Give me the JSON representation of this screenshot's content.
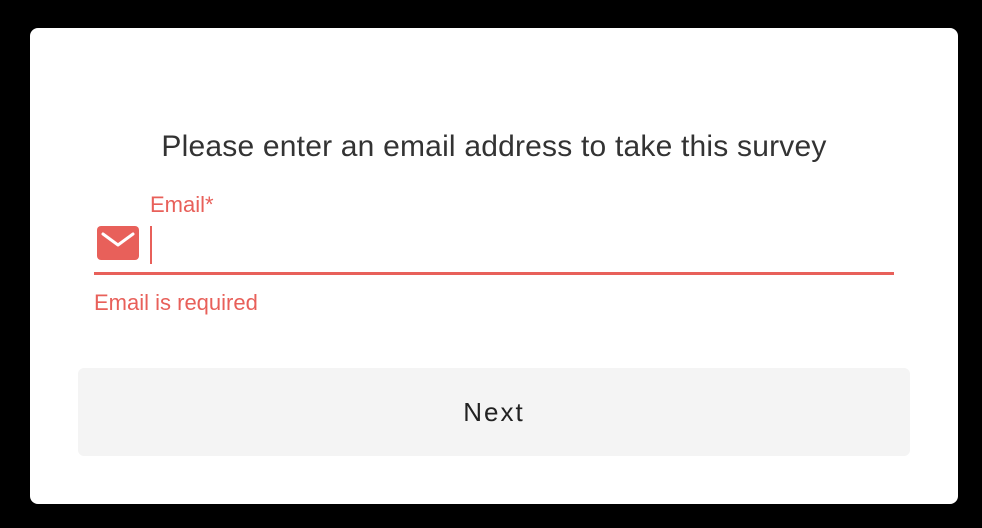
{
  "dialog": {
    "prompt": "Please enter an email address to take this survey",
    "email_field": {
      "label": "Email*",
      "value": "",
      "placeholder": "",
      "error": "Email is required"
    },
    "next_label": "Next"
  },
  "icons": {
    "email_field_icon": "envelope-icon"
  },
  "colors": {
    "error": "#e8605a",
    "text": "#333333",
    "button_bg": "#f4f4f4",
    "card_bg": "#ffffff",
    "backdrop": "#000000"
  }
}
